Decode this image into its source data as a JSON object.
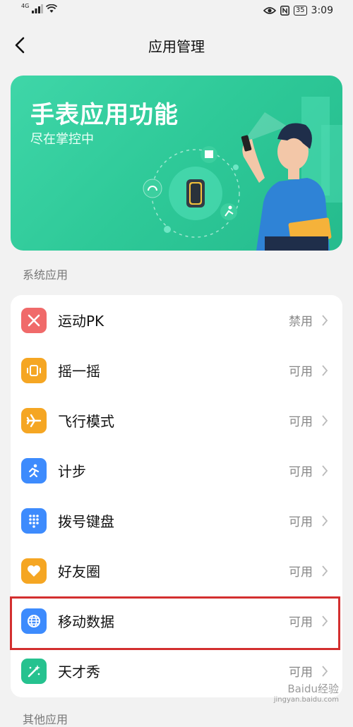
{
  "status_bar": {
    "network": "4G",
    "battery": "35",
    "time": "3:09"
  },
  "header": {
    "title": "应用管理"
  },
  "banner": {
    "title": "手表应用功能",
    "subtitle": "尽在掌控中"
  },
  "sections": {
    "system_title": "系统应用",
    "other_title": "其他应用"
  },
  "apps": [
    {
      "name": "运动PK",
      "status": "禁用",
      "icon": "sports-pk-icon",
      "color": "#f06a6a"
    },
    {
      "name": "摇一摇",
      "status": "可用",
      "icon": "shake-icon",
      "color": "#f5a623"
    },
    {
      "name": "飞行模式",
      "status": "可用",
      "icon": "airplane-icon",
      "color": "#f5a623"
    },
    {
      "name": "计步",
      "status": "可用",
      "icon": "step-counter-icon",
      "color": "#3d8bfd"
    },
    {
      "name": "拨号键盘",
      "status": "可用",
      "icon": "dialpad-icon",
      "color": "#3d8bfd"
    },
    {
      "name": "好友圈",
      "status": "可用",
      "icon": "heart-icon",
      "color": "#f5a623"
    },
    {
      "name": "移动数据",
      "status": "可用",
      "icon": "globe-icon",
      "color": "#3d8bfd"
    },
    {
      "name": "天才秀",
      "status": "可用",
      "icon": "magic-wand-icon",
      "color": "#26c28f"
    }
  ],
  "watermark": {
    "text": "Baidu经验",
    "sub": "jingyan.baidu.com"
  }
}
